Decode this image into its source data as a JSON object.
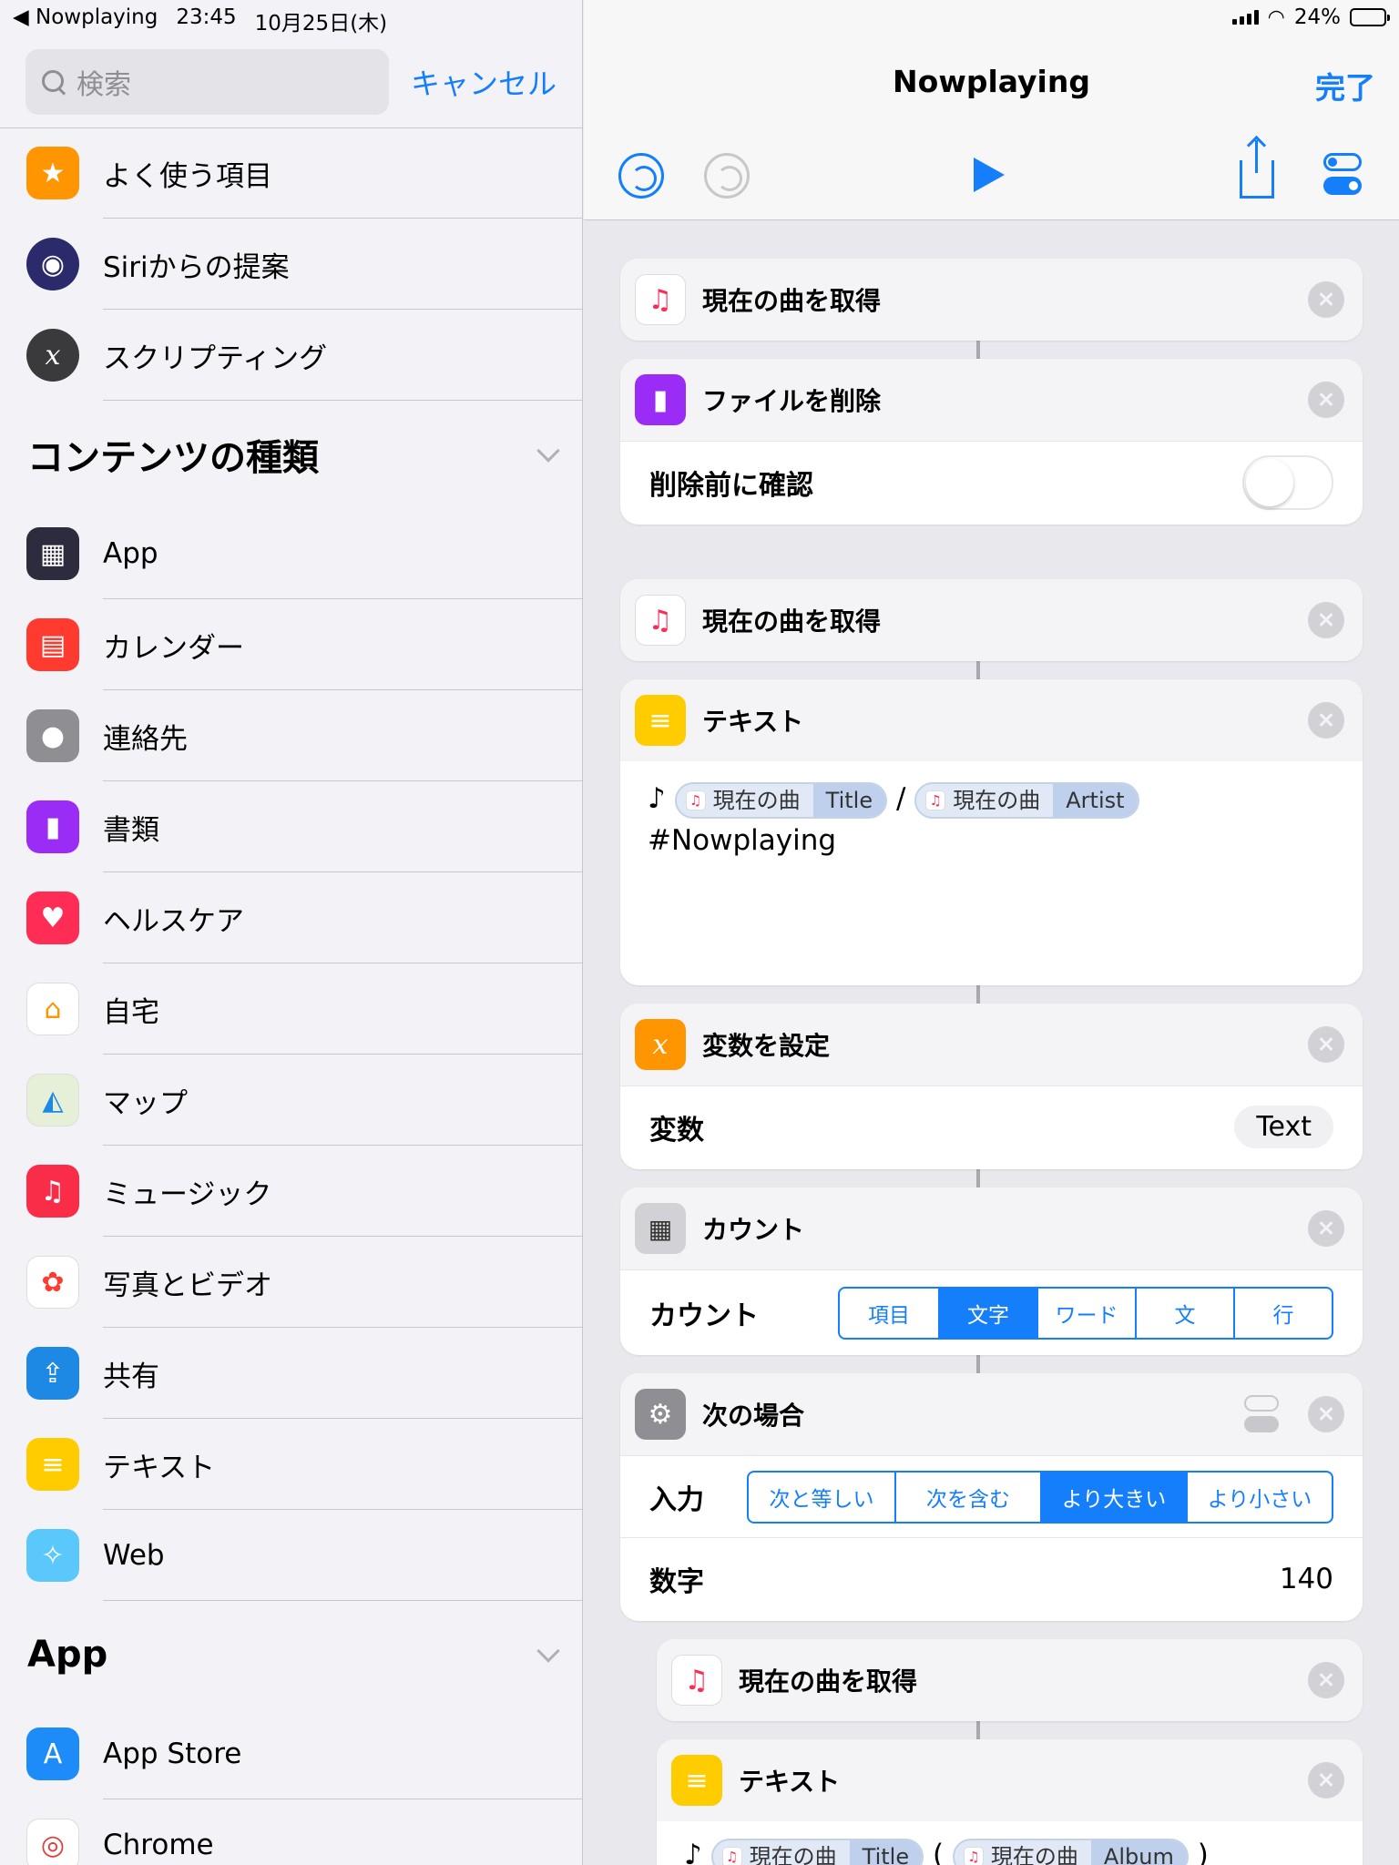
{
  "status": {
    "back_app": "Nowplaying",
    "time": "23:45",
    "date": "10月25日(木)",
    "battery": "24%"
  },
  "sidebar": {
    "search_placeholder": "検索",
    "cancel": "キャンセル",
    "top_items": [
      {
        "label": "よく使う項目",
        "icon": "star-icon",
        "color": "#ff9500"
      },
      {
        "label": "Siriからの提案",
        "icon": "siri-icon",
        "color": "#2b2b6b"
      },
      {
        "label": "スクリプティング",
        "icon": "variable-icon",
        "color": "#3a3a3c"
      }
    ],
    "section_content": "コンテンツの種類",
    "content_items": [
      {
        "label": "App",
        "icon": "app-grid-icon",
        "color": "#2c2c3e"
      },
      {
        "label": "カレンダー",
        "icon": "calendar-icon",
        "color": "#ff3b30"
      },
      {
        "label": "連絡先",
        "icon": "contact-icon",
        "color": "#8e8e93"
      },
      {
        "label": "書類",
        "icon": "document-icon",
        "color": "#9b2cf5"
      },
      {
        "label": "ヘルスケア",
        "icon": "heart-icon",
        "color": "#ff2d55"
      },
      {
        "label": "自宅",
        "icon": "home-icon",
        "color": "#ffffff"
      },
      {
        "label": "マップ",
        "icon": "map-icon",
        "color": "#e6f0d9"
      },
      {
        "label": "ミュージック",
        "icon": "music-icon",
        "color": "#fa2d48"
      },
      {
        "label": "写真とビデオ",
        "icon": "photos-icon",
        "color": "#ffffff"
      },
      {
        "label": "共有",
        "icon": "share-icon",
        "color": "#1e88e5"
      },
      {
        "label": "テキスト",
        "icon": "text-icon",
        "color": "#ffcc00"
      },
      {
        "label": "Web",
        "icon": "safari-icon",
        "color": "#5ac8fa"
      }
    ],
    "section_app": "App",
    "app_items": [
      {
        "label": "App Store",
        "icon": "appstore-icon",
        "color": "#1d8cf8"
      },
      {
        "label": "Chrome",
        "icon": "chrome-icon",
        "color": "#ffffff"
      }
    ]
  },
  "editor": {
    "title": "Nowplaying",
    "done": "完了",
    "actions": {
      "get_song_1": "現在の曲を取得",
      "delete_file": "ファイルを削除",
      "confirm_before_delete": "削除前に確認",
      "get_song_2": "現在の曲を取得",
      "text_1": "テキスト",
      "text_1_note": "♪",
      "token_song": "現在の曲",
      "token_title": "Title",
      "token_artist": "Artist",
      "token_album": "Album",
      "slash": "/",
      "hashtag": "#Nowplaying",
      "set_variable": "変数を設定",
      "variable_label": "変数",
      "variable_value": "Text",
      "count": "カウント",
      "count_label": "カウント",
      "count_options": [
        "項目",
        "文字",
        "ワード",
        "文",
        "行"
      ],
      "count_selected": 1,
      "if": "次の場合",
      "input_label": "入力",
      "if_options": [
        "次と等しい",
        "次を含む",
        "より大きい",
        "より小さい"
      ],
      "if_selected": 2,
      "number_label": "数字",
      "number_value": "140",
      "get_song_3": "現在の曲を取得",
      "text_2": "テキスト",
      "open_paren": "(",
      "close_paren": ")"
    }
  }
}
